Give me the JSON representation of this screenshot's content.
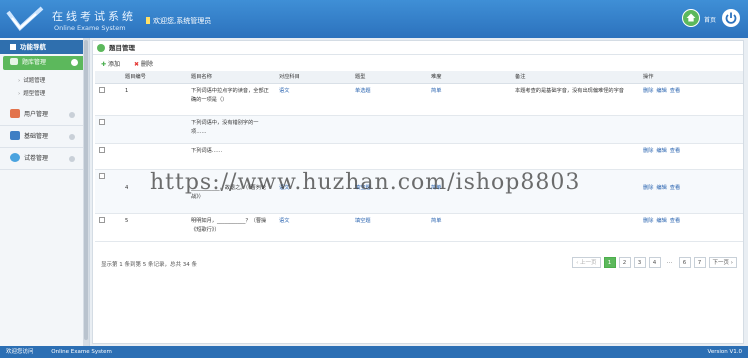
{
  "header": {
    "logo_cn": "在线考试系统",
    "logo_en": "Online Exame System",
    "welcome": "欢迎您,系统管理员",
    "home_label": "首页"
  },
  "sidebar": {
    "title": "功能导航",
    "active": "题库管理",
    "subitems": [
      "试题管理",
      "题型管理"
    ],
    "items": [
      {
        "label": "用户管理",
        "icon": "user-icon",
        "color": "#e2734c"
      },
      {
        "label": "基础管理",
        "icon": "people-icon",
        "color": "#3f7fc4"
      },
      {
        "label": "试卷管理",
        "icon": "paper-icon",
        "color": "#4aa3df"
      }
    ]
  },
  "content": {
    "title": "题目管理",
    "toolbar": {
      "add": "添加",
      "delete": "删除"
    },
    "columns": [
      "题目编号",
      "题目名称",
      "对应科目",
      "题型",
      "难度",
      "备注",
      "操作"
    ],
    "rows": [
      {
        "id": "1",
        "name": "下列词语中拉点字的读音，全部正确的一项是（）",
        "subject": "语文",
        "type": "单选题",
        "level": "简单",
        "note": "本题考查的是基础字音，没有出现偏难怪的字音",
        "ops": [
          "删除",
          "编辑",
          "查看"
        ]
      },
      {
        "id": "",
        "name": "下列词语中，没有错别字的一项……",
        "subject": "",
        "type": "",
        "level": "",
        "note": "",
        "ops": []
      },
      {
        "id": "",
        "name": "下列词语……",
        "subject": "",
        "type": "",
        "level": "",
        "note": "",
        "ops": [
          "删除",
          "编辑",
          "查看"
        ]
      },
      {
        "id": "4",
        "name": "___________，故退之。（《曹刿论战》）",
        "subject": "语文",
        "type": "填空题",
        "level": "简单",
        "note": "",
        "ops": [
          "删除",
          "编辑",
          "查看"
        ]
      },
      {
        "id": "5",
        "name": "明明如月，___________？（曹操《短歌行》）",
        "subject": "语文",
        "type": "填空题",
        "level": "简单",
        "note": "",
        "ops": [
          "删除",
          "编辑",
          "查看"
        ]
      }
    ],
    "pager_info": "显示第 1 条到第 5 条记录，总共 34 条",
    "pager": [
      "‹ 上一页",
      "1",
      "2",
      "3",
      "4",
      "…",
      "6",
      "7",
      "下一页 ›"
    ]
  },
  "watermark": "https://www.huzhan.com/ishop8803",
  "footer": {
    "left": "欢迎您访问",
    "system": "Online Exame System",
    "version": "Version V1.0"
  }
}
